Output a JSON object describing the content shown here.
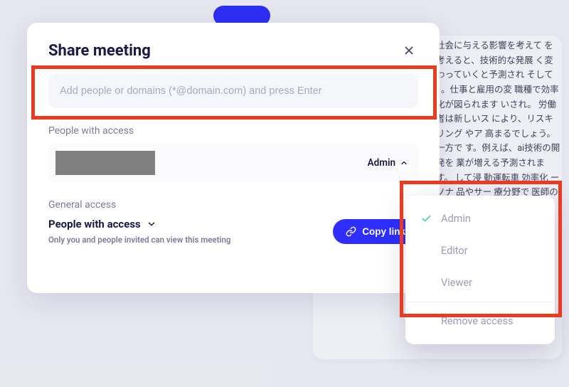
{
  "modal": {
    "title": "Share meeting",
    "input_placeholder": "Add people or domains (*@domain.com) and press Enter",
    "people_label": "People with access",
    "person": {
      "role": "Admin"
    },
    "general_label": "General access",
    "access_scope": "People with access",
    "access_note": "Only you and people invited can view this meeting",
    "copy_label": "Copy link"
  },
  "dropdown": {
    "admin": "Admin",
    "editor": "Editor",
    "viewer": "Viewer",
    "remove": "Remove access"
  },
  "bg": {
    "text": "社会に与える影響を考えて を考えると、技術的な発展 く変わっていくと予測され そして1。仕事と雇用の変 職種で効率化が図られます いされ。 労働者は新しいス により、リスキリング やア 高まるでしょう。 一方で す。例えば、ai技術の開発を 業が増える予測されます。 して浸 動運転車 効率化 ーソナ 品やサー 療分野で 医師の実 切な治療 療現場の 良 た！ 治療"
  }
}
